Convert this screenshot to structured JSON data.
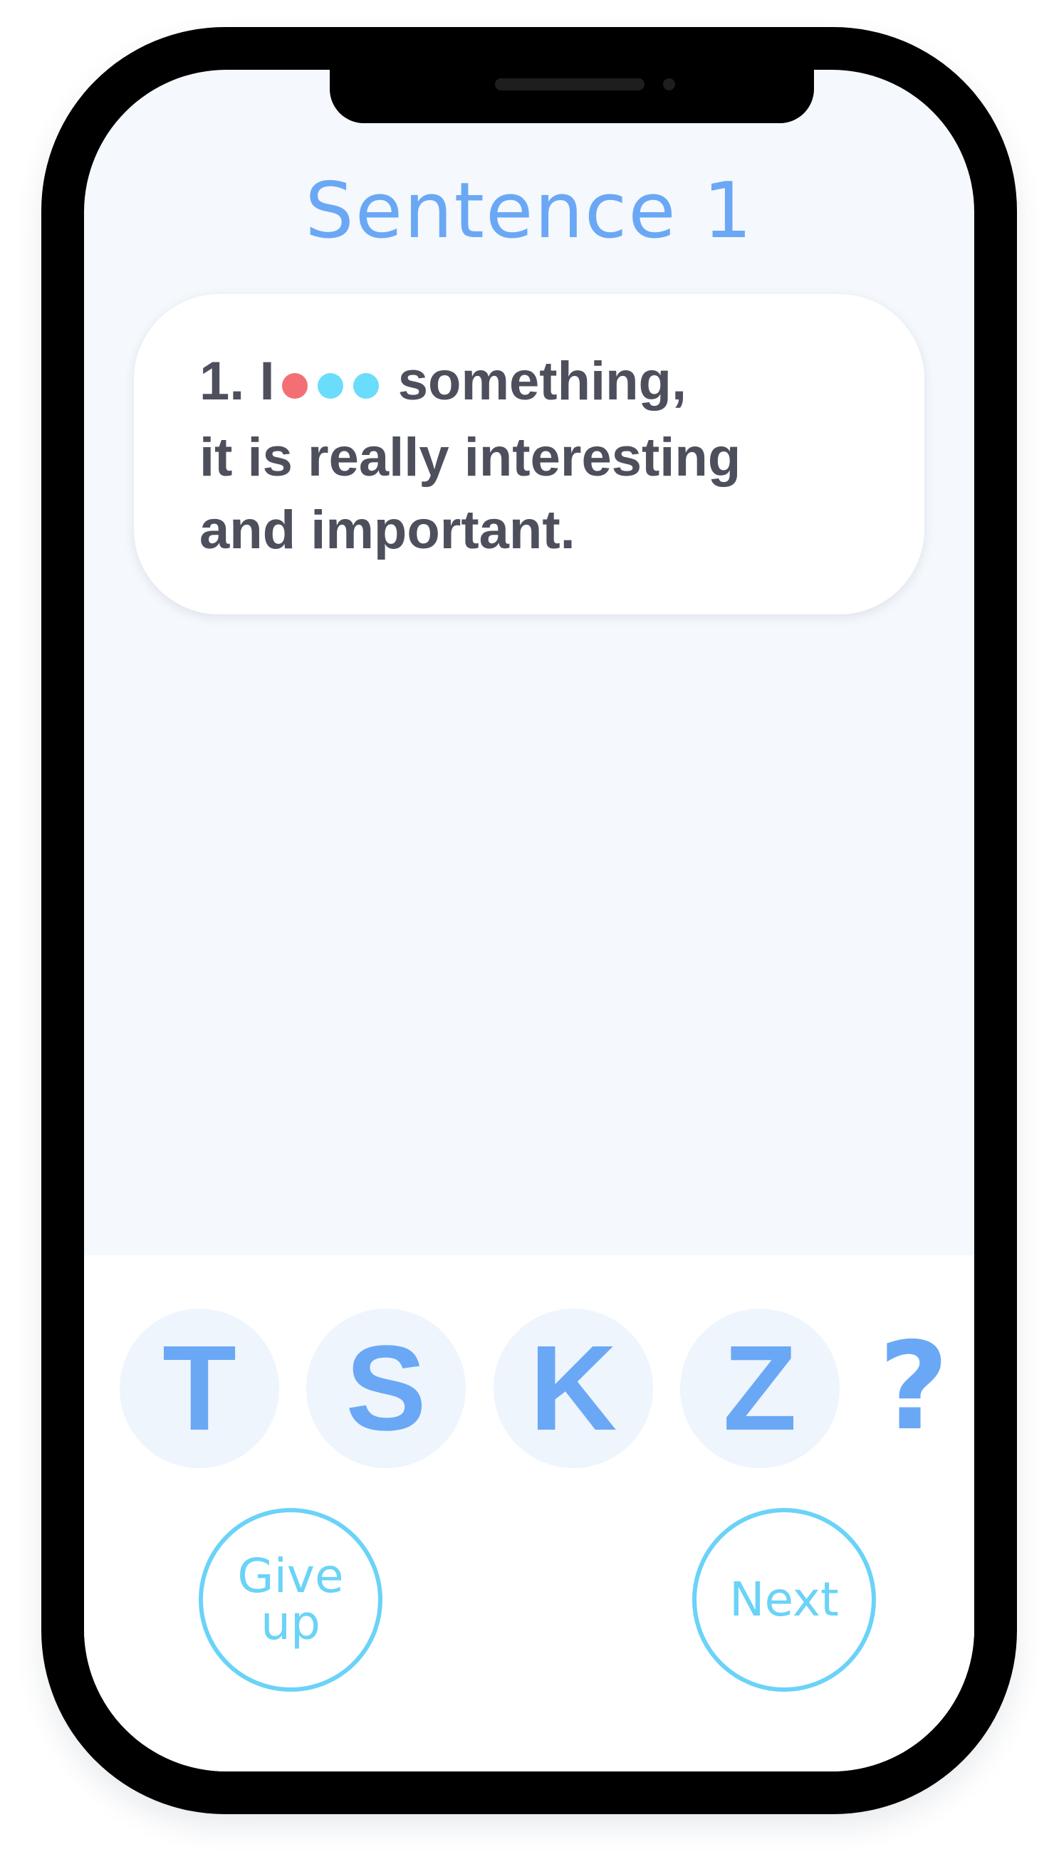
{
  "title": "Sentence 1",
  "sentence": {
    "prefix": "1. I",
    "dots": [
      "#f36f73",
      "#6adcfc",
      "#6adcfc"
    ],
    "line1_suffix": "something,",
    "line2": "it is really interesting",
    "line3": "and important."
  },
  "keys": [
    "T",
    "S",
    "K",
    "Z"
  ],
  "help_key": "?",
  "buttons": {
    "give_up_line1": "Give",
    "give_up_line2": "up",
    "next": "Next"
  },
  "colors": {
    "accent": "#6aa8f5",
    "button_outline": "#6ad3f7",
    "text": "#4d4f5c"
  }
}
